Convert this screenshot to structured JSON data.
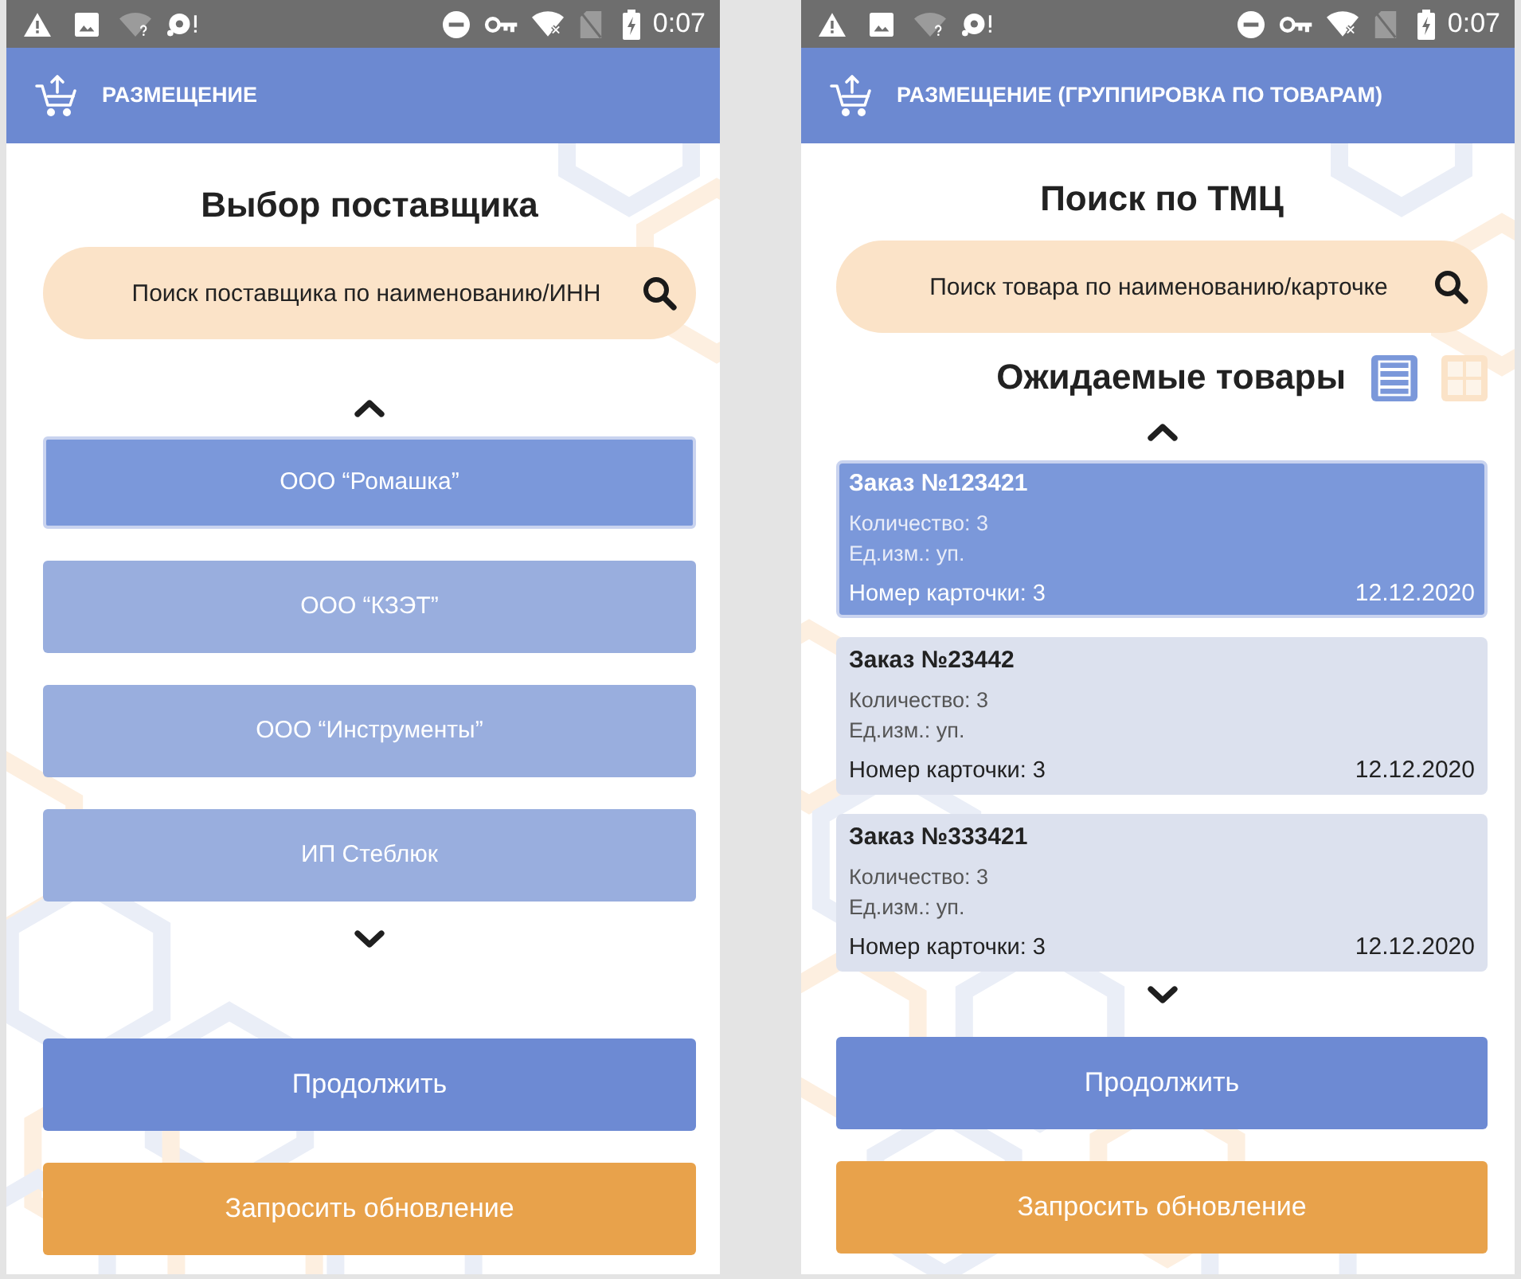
{
  "screens": [
    {
      "kind": "suppliers",
      "status_bar": {
        "time": "0:07"
      },
      "app_bar": {
        "title": "РАЗМЕЩЕНИЕ"
      },
      "heading": "Выбор поставщика",
      "search": {
        "placeholder": "Поиск поставщика по наименованию/ИНН"
      },
      "suppliers": [
        {
          "name": "ООО “Ромашка”",
          "selected": true
        },
        {
          "name": "ООО “КЗЭТ”",
          "selected": false
        },
        {
          "name": "ООО “Инструменты”",
          "selected": false
        },
        {
          "name": "ИП Стеблюк",
          "selected": false
        }
      ],
      "buttons": [
        {
          "kind": "continue",
          "label": "Продолжить"
        },
        {
          "kind": "refresh",
          "label": "Запросить обновление"
        }
      ]
    },
    {
      "kind": "goods",
      "status_bar": {
        "time": "0:07"
      },
      "app_bar": {
        "title": "РАЗМЕЩЕНИЕ (ГРУППИРОВКА ПО ТОВАРАМ)"
      },
      "heading": "Поиск по ТМЦ",
      "search": {
        "placeholder": "Поиск товара по наименованию/карточке"
      },
      "section": {
        "title": "Ожидаемые товары",
        "views": [
          {
            "kind": "list",
            "selected": true
          },
          {
            "kind": "grid",
            "selected": false
          }
        ]
      },
      "orders": [
        {
          "title": "Заказ №123421",
          "quantity": "Количество: 3",
          "unit": "Ед.изм.: уп.",
          "card_number": "Номер карточки: 3",
          "date": "12.12.2020",
          "selected": true
        },
        {
          "title": "Заказ №23442",
          "quantity": "Количество: 3",
          "unit": "Ед.изм.: уп.",
          "card_number": "Номер карточки: 3",
          "date": "12.12.2020",
          "selected": false
        },
        {
          "title": "Заказ №333421",
          "quantity": "Количество: 3",
          "unit": "Ед.изм.: уп.",
          "card_number": "Номер карточки: 3",
          "date": "12.12.2020",
          "selected": false
        }
      ],
      "buttons": [
        {
          "kind": "continue",
          "label": "Продолжить"
        },
        {
          "kind": "refresh",
          "label": "Запросить обновление"
        }
      ]
    }
  ]
}
